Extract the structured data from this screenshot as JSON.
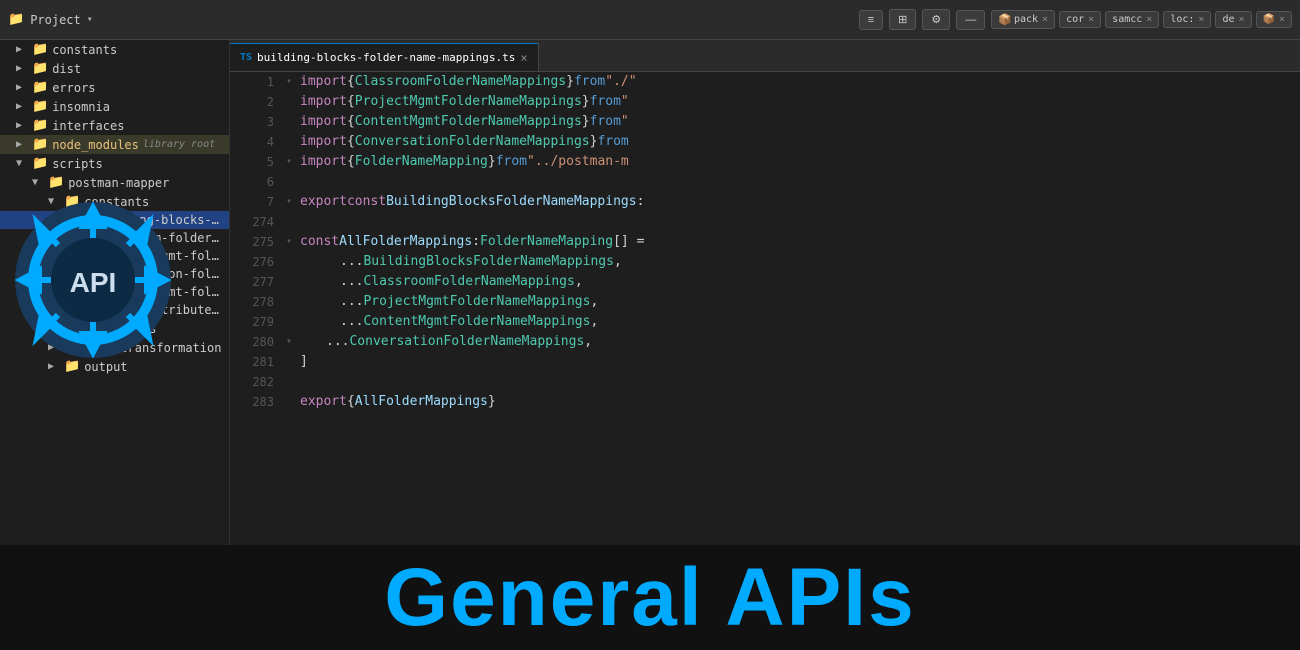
{
  "toolbar": {
    "project_label": "Project",
    "dropdown_arrow": "▾",
    "icon_align": "≡",
    "icon_split": "⊞",
    "icon_gear": "⚙",
    "icon_minus": "—",
    "chips": [
      {
        "label": "pack",
        "close": "×"
      },
      {
        "label": "cor",
        "close": "×"
      },
      {
        "label": "samcc",
        "close": "×"
      },
      {
        "label": "loc:",
        "close": "×"
      },
      {
        "label": "de",
        "close": "×"
      },
      {
        "label": "📦",
        "close": "×"
      }
    ]
  },
  "sidebar": {
    "items": [
      {
        "id": "constants",
        "type": "folder",
        "label": "constants",
        "depth": 1,
        "collapsed": true
      },
      {
        "id": "dist",
        "type": "folder",
        "label": "dist",
        "depth": 1,
        "collapsed": true
      },
      {
        "id": "errors",
        "type": "folder",
        "label": "errors",
        "depth": 1,
        "collapsed": true
      },
      {
        "id": "insomnia",
        "type": "folder",
        "label": "insomnia",
        "depth": 1,
        "collapsed": true
      },
      {
        "id": "interfaces",
        "type": "folder",
        "label": "interfaces",
        "depth": 1,
        "collapsed": true
      },
      {
        "id": "node_modules",
        "type": "folder",
        "label": "node_modules",
        "badge": "library root",
        "depth": 1,
        "collapsed": true,
        "highlighted": true
      },
      {
        "id": "scripts",
        "type": "folder",
        "label": "scripts",
        "depth": 1,
        "collapsed": false
      },
      {
        "id": "postman-mapper",
        "type": "folder",
        "label": "postman-mapper",
        "depth": 2,
        "collapsed": false
      },
      {
        "id": "constants2",
        "type": "folder",
        "label": "constants",
        "depth": 3,
        "collapsed": false
      },
      {
        "id": "building-blocks-folder-name-mappings.ts",
        "type": "file",
        "label": "building-blocks-folder-name-mappings.ts",
        "depth": 4,
        "selected": true
      },
      {
        "id": "classroom-folder-name-mappings.ts",
        "type": "file",
        "label": "classroom-folder-name-mappings.ts",
        "depth": 4
      },
      {
        "id": "content-mgmt-folder-name-mappings.ts",
        "type": "file",
        "label": "content-mgmt-folder-name-mappings.ts",
        "depth": 4
      },
      {
        "id": "conversation-folder-name-mappings.ts",
        "type": "file",
        "label": "conversation-folder-name-mappings.ts",
        "depth": 4
      },
      {
        "id": "project-mgmt-folder-name-mappings.ts",
        "type": "file",
        "label": "project-mgmt-folder-name-mappings.ts",
        "depth": 4
      },
      {
        "id": "static-attributes.ts",
        "type": "file",
        "label": "static-attributes.ts",
        "depth": 4
      },
      {
        "id": "interfaces2",
        "type": "folder",
        "label": "interfaces",
        "depth": 3,
        "collapsed": true
      },
      {
        "id": "json-transformation",
        "type": "folder",
        "label": "json-transformation",
        "depth": 3,
        "collapsed": true
      },
      {
        "id": "output",
        "type": "folder",
        "label": "output",
        "depth": 3,
        "collapsed": true
      }
    ]
  },
  "editor": {
    "active_tab": "building-blocks-folder-name-mappings.ts",
    "lines": [
      {
        "num": 1,
        "tokens": [
          {
            "t": "kw",
            "v": "import"
          },
          {
            "t": "pun",
            "v": " { "
          },
          {
            "t": "cls",
            "v": "ClassroomFolderNameMappings"
          },
          {
            "t": "pun",
            "v": " } "
          },
          {
            "t": "kw2",
            "v": "from"
          },
          {
            "t": "str",
            "v": " \"./"
          }
        ]
      },
      {
        "num": 2,
        "tokens": [
          {
            "t": "kw",
            "v": "import"
          },
          {
            "t": "pun",
            "v": " { "
          },
          {
            "t": "cls",
            "v": "ProjectMgmtFolderNameMappings"
          },
          {
            "t": "pun",
            "v": " } "
          },
          {
            "t": "kw2",
            "v": "from"
          },
          {
            "t": "str",
            "v": " \""
          }
        ]
      },
      {
        "num": 3,
        "tokens": [
          {
            "t": "kw",
            "v": "import"
          },
          {
            "t": "pun",
            "v": " { "
          },
          {
            "t": "cls",
            "v": "ContentMgmtFolderNameMappings"
          },
          {
            "t": "pun",
            "v": " } "
          },
          {
            "t": "kw2",
            "v": "from"
          },
          {
            "t": "str",
            "v": " \""
          }
        ]
      },
      {
        "num": 4,
        "tokens": [
          {
            "t": "kw",
            "v": "import"
          },
          {
            "t": "pun",
            "v": " { "
          },
          {
            "t": "cls",
            "v": "ConversationFolderNameMappings"
          },
          {
            "t": "pun",
            "v": " } "
          },
          {
            "t": "kw2",
            "v": "from"
          }
        ]
      },
      {
        "num": 5,
        "tokens": [
          {
            "t": "kw",
            "v": "import"
          },
          {
            "t": "pun",
            "v": " { "
          },
          {
            "t": "cls",
            "v": "FolderNameMapping"
          },
          {
            "t": "pun",
            "v": " } "
          },
          {
            "t": "kw2",
            "v": "from"
          },
          {
            "t": "str",
            "v": " \"../postman-m"
          }
        ]
      },
      {
        "num": 6,
        "tokens": []
      },
      {
        "num": 7,
        "tokens": [
          {
            "t": "kw",
            "v": "export"
          },
          {
            "t": "pun",
            "v": " "
          },
          {
            "t": "kw",
            "v": "const"
          },
          {
            "t": "pun",
            "v": " "
          },
          {
            "t": "var",
            "v": "BuildingBlocksFolderNameMappings"
          },
          {
            "t": "pun",
            "v": ":"
          }
        ]
      },
      {
        "num": "274",
        "tokens": []
      },
      {
        "num": "275",
        "tokens": [
          {
            "t": "kw",
            "v": "const"
          },
          {
            "t": "pun",
            "v": " "
          },
          {
            "t": "var",
            "v": "AllFolderMappings"
          },
          {
            "t": "pun",
            "v": ": "
          },
          {
            "t": "cls",
            "v": "FolderNameMapping"
          },
          {
            "t": "pun",
            "v": "[] = "
          }
        ]
      },
      {
        "num": "276",
        "tokens": [
          {
            "t": "spread",
            "v": "    ..."
          },
          {
            "t": "cls",
            "v": "BuildingBlocksFolderNameMappings"
          },
          {
            "t": "pun",
            "v": ","
          }
        ]
      },
      {
        "num": "277",
        "tokens": [
          {
            "t": "spread",
            "v": "    ..."
          },
          {
            "t": "cls",
            "v": "ClassroomFolderNameMappings"
          },
          {
            "t": "pun",
            "v": ","
          }
        ]
      },
      {
        "num": "278",
        "tokens": [
          {
            "t": "spread",
            "v": "    ..."
          },
          {
            "t": "cls",
            "v": "ProjectMgmtFolderNameMappings"
          },
          {
            "t": "pun",
            "v": ","
          }
        ]
      },
      {
        "num": "279",
        "tokens": [
          {
            "t": "spread",
            "v": "    ..."
          },
          {
            "t": "cls",
            "v": "ContentMgmtFolderNameMappings"
          },
          {
            "t": "pun",
            "v": ","
          }
        ]
      },
      {
        "num": "280",
        "tokens": [
          {
            "t": "spread",
            "v": "    ..."
          },
          {
            "t": "cls",
            "v": "ConversationFolderNameMappings"
          },
          {
            "t": "pun",
            "v": ","
          }
        ]
      },
      {
        "num": "281",
        "tokens": [
          {
            "t": "pun",
            "v": "]"
          }
        ]
      },
      {
        "num": "282",
        "tokens": []
      },
      {
        "num": "283",
        "tokens": [
          {
            "t": "kw",
            "v": "export"
          },
          {
            "t": "pun",
            "v": " { "
          },
          {
            "t": "var",
            "v": "AllFolderMappings"
          },
          {
            "t": "pun",
            "v": " }"
          }
        ]
      }
    ]
  },
  "bottom": {
    "title": "General APIs"
  }
}
